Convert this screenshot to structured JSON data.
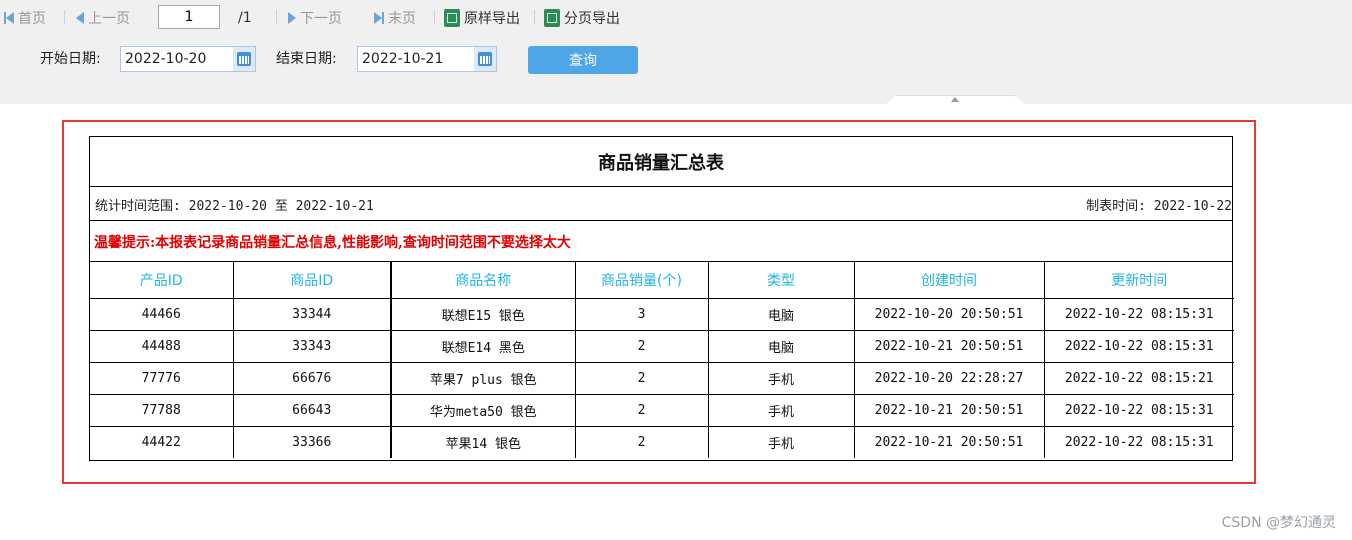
{
  "toolbar": {
    "first_label": "首页",
    "prev_label": "上一页",
    "page_value": "1",
    "page_total": "/1",
    "next_label": "下一页",
    "last_label": "末页",
    "export_original_label": "原样导出",
    "export_paged_label": "分页导出"
  },
  "filter": {
    "start_label": "开始日期:",
    "start_value": "2022-10-20",
    "end_label": "结束日期:",
    "end_value": "2022-10-21",
    "query_label": "查询"
  },
  "report": {
    "title": "商品销量汇总表",
    "range_text": "统计时间范围: 2022-10-20 至 2022-10-21",
    "made_text": "制表时间: 2022-10-22",
    "warning": "温馨提示:本报表记录商品销量汇总信息,性能影响,查询时间范围不要选择太大",
    "columns": [
      "产品ID",
      "商品ID",
      "商品名称",
      "商品销量(个)",
      "类型",
      "创建时间",
      "更新时间"
    ],
    "rows": [
      [
        "44466",
        "33344",
        "联想E15 银色",
        "3",
        "电脑",
        "2022-10-20 20:50:51",
        "2022-10-22 08:15:31"
      ],
      [
        "44488",
        "33343",
        "联想E14 黑色",
        "2",
        "电脑",
        "2022-10-21 20:50:51",
        "2022-10-22 08:15:31"
      ],
      [
        "77776",
        "66676",
        "苹果7 plus 银色",
        "2",
        "手机",
        "2022-10-20 22:28:27",
        "2022-10-22 08:15:21"
      ],
      [
        "77788",
        "66643",
        "华为meta50 银色",
        "2",
        "手机",
        "2022-10-21 20:50:51",
        "2022-10-22 08:15:31"
      ],
      [
        "44422",
        "33366",
        "苹果14 银色",
        "2",
        "手机",
        "2022-10-21 20:50:51",
        "2022-10-22 08:15:31"
      ]
    ]
  },
  "watermark": "CSDN @梦幻通灵",
  "colors": {
    "accent": "#4fa6e6",
    "header_text": "#1fb6e6",
    "warning_text": "#e00000",
    "highlight_frame": "#e53935"
  },
  "icons": [
    "first-page-icon",
    "prev-page-icon",
    "next-page-icon",
    "last-page-icon",
    "excel-icon",
    "calendar-icon"
  ]
}
